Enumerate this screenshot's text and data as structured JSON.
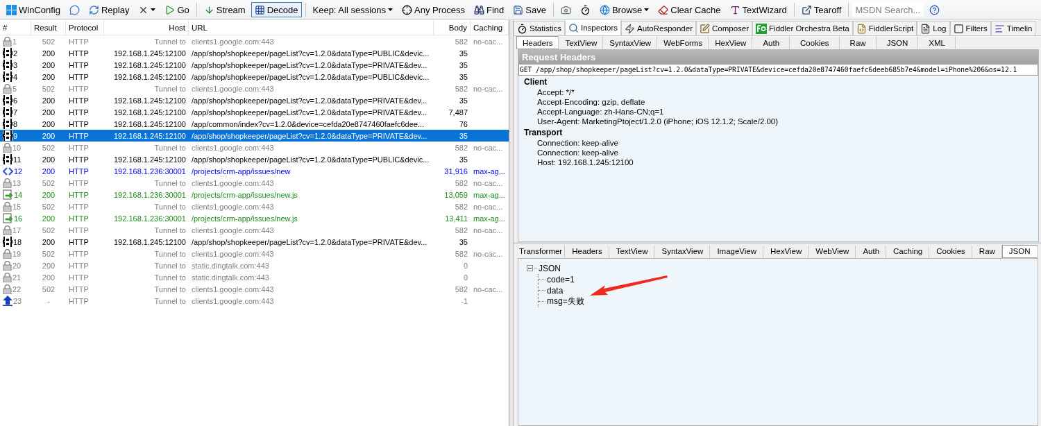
{
  "toolbar": [
    {
      "kind": "button",
      "label": "WinConfig",
      "selected": false,
      "dropdown": false
    },
    {
      "kind": "icon",
      "selected": false,
      "dropdown": false
    },
    {
      "kind": "button",
      "label": "Replay",
      "selected": false,
      "dropdown": false
    },
    {
      "kind": "icon",
      "selected": false,
      "dropdown": true
    },
    {
      "kind": "button",
      "label": "Go",
      "selected": false,
      "dropdown": false
    },
    {
      "kind": "separator"
    },
    {
      "kind": "button",
      "label": "Stream",
      "selected": false,
      "dropdown": false
    },
    {
      "kind": "button",
      "label": "Decode",
      "selected": true,
      "dropdown": false
    },
    {
      "kind": "separator"
    },
    {
      "kind": "button",
      "label": "Keep: All sessions",
      "selected": false,
      "dropdown": true
    },
    {
      "kind": "button",
      "label": "Any Process",
      "selected": false,
      "dropdown": false
    },
    {
      "kind": "button",
      "label": "Find",
      "selected": false,
      "dropdown": false
    },
    {
      "kind": "button",
      "label": "Save",
      "selected": false,
      "dropdown": false
    },
    {
      "kind": "separator"
    },
    {
      "kind": "icon",
      "selected": false,
      "dropdown": false
    },
    {
      "kind": "icon",
      "selected": false,
      "dropdown": false
    },
    {
      "kind": "button",
      "label": "Browse",
      "selected": false,
      "dropdown": true
    },
    {
      "kind": "button",
      "label": "Clear Cache",
      "selected": false,
      "dropdown": false
    },
    {
      "kind": "button",
      "label": "TextWizard",
      "selected": false,
      "dropdown": false
    },
    {
      "kind": "separator"
    },
    {
      "kind": "button",
      "label": "Tearoff",
      "selected": false,
      "dropdown": false
    },
    {
      "kind": "separator"
    },
    {
      "kind": "search",
      "placeholder": "MSDN Search..."
    },
    {
      "kind": "icon",
      "selected": false,
      "dropdown": false
    }
  ],
  "sessions": {
    "columns": [
      "#",
      "Result",
      "Protocol",
      "Host",
      "URL",
      "Body",
      "Caching"
    ],
    "rows": [
      {
        "kind": "lock",
        "color": "#808080",
        "selected": false,
        "cells": [
          "1",
          "502",
          "HTTP",
          "Tunnel to",
          "clients1.google.com:443",
          "582",
          "no-cac..."
        ]
      },
      {
        "kind": "json",
        "color": "#000000",
        "selected": false,
        "cells": [
          "2",
          "200",
          "HTTP",
          "192.168.1.245:12100",
          "/app/shop/shopkeeper/pageList?cv=1.2.0&dataType=PUBLIC&devic...",
          "35",
          ""
        ]
      },
      {
        "kind": "json",
        "color": "#000000",
        "selected": false,
        "cells": [
          "3",
          "200",
          "HTTP",
          "192.168.1.245:12100",
          "/app/shop/shopkeeper/pageList?cv=1.2.0&dataType=PRIVATE&dev...",
          "35",
          ""
        ]
      },
      {
        "kind": "json",
        "color": "#000000",
        "selected": false,
        "cells": [
          "4",
          "200",
          "HTTP",
          "192.168.1.245:12100",
          "/app/shop/shopkeeper/pageList?cv=1.2.0&dataType=PUBLIC&devic...",
          "35",
          ""
        ]
      },
      {
        "kind": "lock",
        "color": "#808080",
        "selected": false,
        "cells": [
          "5",
          "502",
          "HTTP",
          "Tunnel to",
          "clients1.google.com:443",
          "582",
          "no-cac..."
        ]
      },
      {
        "kind": "json",
        "color": "#000000",
        "selected": false,
        "cells": [
          "6",
          "200",
          "HTTP",
          "192.168.1.245:12100",
          "/app/shop/shopkeeper/pageList?cv=1.2.0&dataType=PRIVATE&dev...",
          "35",
          ""
        ]
      },
      {
        "kind": "json",
        "color": "#000000",
        "selected": false,
        "cells": [
          "7",
          "200",
          "HTTP",
          "192.168.1.245:12100",
          "/app/shop/shopkeeper/pageList?cv=1.2.0&dataType=PRIVATE&dev...",
          "7,487",
          ""
        ]
      },
      {
        "kind": "json",
        "color": "#000000",
        "selected": false,
        "cells": [
          "8",
          "200",
          "HTTP",
          "192.168.1.245:12100",
          "/app/common/index?cv=1.2.0&device=cefda20e8747460faefc6dee...",
          "76",
          ""
        ]
      },
      {
        "kind": "json",
        "color": "#000000",
        "selected": true,
        "cells": [
          "9",
          "200",
          "HTTP",
          "192.168.1.245:12100",
          "/app/shop/shopkeeper/pageList?cv=1.2.0&dataType=PRIVATE&dev...",
          "35",
          ""
        ]
      },
      {
        "kind": "lock",
        "color": "#808080",
        "selected": false,
        "cells": [
          "10",
          "502",
          "HTTP",
          "Tunnel to",
          "clients1.google.com:443",
          "582",
          "no-cac..."
        ]
      },
      {
        "kind": "json",
        "color": "#000000",
        "selected": false,
        "cells": [
          "11",
          "200",
          "HTTP",
          "192.168.1.245:12100",
          "/app/shop/shopkeeper/pageList?cv=1.2.0&dataType=PUBLIC&devic...",
          "35",
          ""
        ]
      },
      {
        "kind": "markup",
        "color": "#0000ff",
        "selected": false,
        "cells": [
          "12",
          "200",
          "HTTP",
          "192.168.1.236:30001",
          "/projects/crm-app/issues/new",
          "31,916",
          "max-ag..."
        ]
      },
      {
        "kind": "lock",
        "color": "#808080",
        "selected": false,
        "cells": [
          "13",
          "502",
          "HTTP",
          "Tunnel to",
          "clients1.google.com:443",
          "582",
          "no-cac..."
        ]
      },
      {
        "kind": "script",
        "color": "#1a8f1a",
        "selected": false,
        "cells": [
          "14",
          "200",
          "HTTP",
          "192.168.1.236:30001",
          "/projects/crm-app/issues/new.js",
          "13,059",
          "max-ag..."
        ]
      },
      {
        "kind": "lock",
        "color": "#808080",
        "selected": false,
        "cells": [
          "15",
          "502",
          "HTTP",
          "Tunnel to",
          "clients1.google.com:443",
          "582",
          "no-cac..."
        ]
      },
      {
        "kind": "script",
        "color": "#1a8f1a",
        "selected": false,
        "cells": [
          "16",
          "200",
          "HTTP",
          "192.168.1.236:30001",
          "/projects/crm-app/issues/new.js",
          "13,411",
          "max-ag..."
        ]
      },
      {
        "kind": "lock",
        "color": "#808080",
        "selected": false,
        "cells": [
          "17",
          "502",
          "HTTP",
          "Tunnel to",
          "clients1.google.com:443",
          "582",
          "no-cac..."
        ]
      },
      {
        "kind": "json",
        "color": "#000000",
        "selected": false,
        "cells": [
          "18",
          "200",
          "HTTP",
          "192.168.1.245:12100",
          "/app/shop/shopkeeper/pageList?cv=1.2.0&dataType=PRIVATE&dev...",
          "35",
          ""
        ]
      },
      {
        "kind": "lock",
        "color": "#808080",
        "selected": false,
        "cells": [
          "19",
          "502",
          "HTTP",
          "Tunnel to",
          "clients1.google.com:443",
          "582",
          "no-cac..."
        ]
      },
      {
        "kind": "lock",
        "color": "#808080",
        "selected": false,
        "cells": [
          "20",
          "200",
          "HTTP",
          "Tunnel to",
          "static.dingtalk.com:443",
          "0",
          ""
        ]
      },
      {
        "kind": "lock",
        "color": "#808080",
        "selected": false,
        "cells": [
          "21",
          "200",
          "HTTP",
          "Tunnel to",
          "static.dingtalk.com:443",
          "0",
          ""
        ]
      },
      {
        "kind": "lock",
        "color": "#808080",
        "selected": false,
        "cells": [
          "22",
          "502",
          "HTTP",
          "Tunnel to",
          "clients1.google.com:443",
          "582",
          "no-cac..."
        ]
      },
      {
        "kind": "upload",
        "color": "#808080",
        "selected": false,
        "cells": [
          "23",
          "-",
          "HTTP",
          "Tunnel to",
          "clients1.google.com:443",
          "-1",
          ""
        ]
      }
    ]
  },
  "main_tabs": [
    {
      "label": "Statistics",
      "selected": false
    },
    {
      "label": "Inspectors",
      "selected": true
    },
    {
      "label": "AutoResponder",
      "selected": false
    },
    {
      "label": "Composer",
      "selected": false
    },
    {
      "label": "Fiddler Orchestra Beta",
      "selected": false
    },
    {
      "label": "FiddlerScript",
      "selected": false
    },
    {
      "label": "Log",
      "selected": false
    },
    {
      "label": "Filters",
      "selected": false
    },
    {
      "label": "Timelin",
      "selected": false
    }
  ],
  "request": {
    "tabs": [
      {
        "label": "Headers",
        "selected": true
      },
      {
        "label": "TextView",
        "selected": false
      },
      {
        "label": "SyntaxView",
        "selected": false
      },
      {
        "label": "WebForms",
        "selected": false
      },
      {
        "label": "HexView",
        "selected": false
      },
      {
        "label": "Auth",
        "selected": false
      },
      {
        "label": "Cookies",
        "selected": false
      },
      {
        "label": "Raw",
        "selected": false
      },
      {
        "label": "JSON",
        "selected": false
      },
      {
        "label": "XML",
        "selected": false
      }
    ],
    "title": "Request Headers",
    "request_line": "GET /app/shop/shopkeeper/pageList?cv=1.2.0&dataType=PRIVATE&device=cefda20e8747460faefc6deeb685b7e4&model=iPhone%206&os=12.1",
    "groups": [
      {
        "name": "Client",
        "headers": [
          "Accept: */*",
          "Accept-Encoding: gzip, deflate",
          "Accept-Language: zh-Hans-CN;q=1",
          "User-Agent: MarketingPtoject/1.2.0 (iPhone; iOS 12.1.2; Scale/2.00)"
        ]
      },
      {
        "name": "Transport",
        "headers": [
          "Connection: keep-alive",
          "Connection: keep-alive",
          "Host: 192.168.1.245:12100"
        ]
      }
    ]
  },
  "response": {
    "tabs": [
      {
        "label": "Transformer",
        "selected": false
      },
      {
        "label": "Headers",
        "selected": false
      },
      {
        "label": "TextView",
        "selected": false
      },
      {
        "label": "SyntaxView",
        "selected": false
      },
      {
        "label": "ImageView",
        "selected": false
      },
      {
        "label": "HexView",
        "selected": false
      },
      {
        "label": "WebView",
        "selected": false
      },
      {
        "label": "Auth",
        "selected": false
      },
      {
        "label": "Caching",
        "selected": false
      },
      {
        "label": "Cookies",
        "selected": false
      },
      {
        "label": "Raw",
        "selected": false
      },
      {
        "label": "JSON",
        "selected": true
      }
    ],
    "tree": [
      {
        "label": "JSON",
        "expanded": true,
        "children": [
          {
            "label": "code=1"
          },
          {
            "label": "data"
          },
          {
            "label": "msg=失败"
          }
        ]
      }
    ]
  }
}
